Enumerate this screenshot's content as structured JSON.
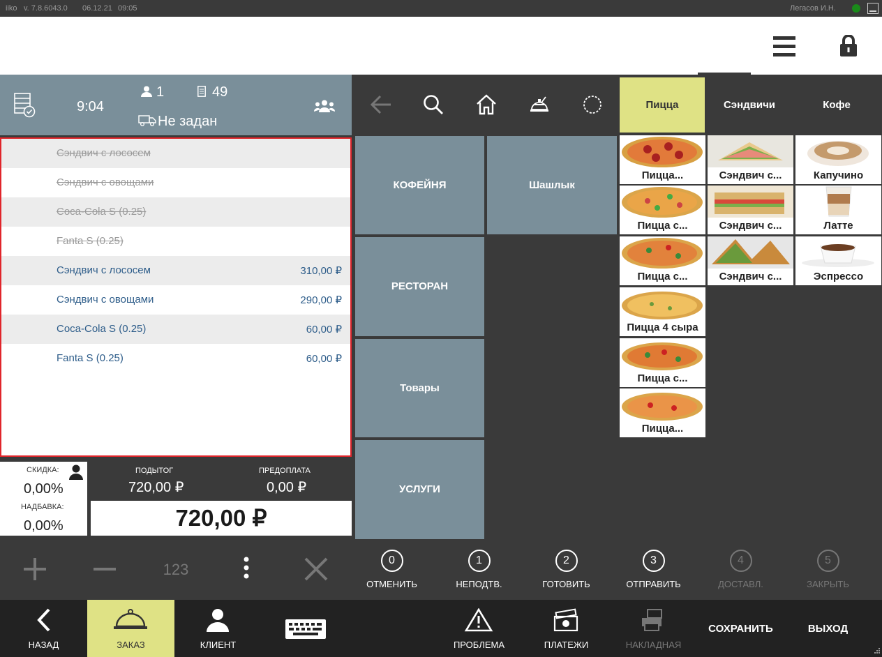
{
  "status_bar": {
    "app": "iiko",
    "version": "v. 7.8.6043.0",
    "date": "06.12.21",
    "time": "09:05",
    "user": "Легасов И.Н."
  },
  "order_header": {
    "time": "9:04",
    "guests": "1",
    "order_number": "49",
    "delivery": "Не задан"
  },
  "order_items": [
    {
      "name": "Сэндвич с лососем",
      "price": "",
      "state": "removed"
    },
    {
      "name": "Сэндвич с овощами",
      "price": "",
      "state": "removed"
    },
    {
      "name": "Coca-Cola S (0.25)",
      "price": "",
      "state": "removed"
    },
    {
      "name": "Fanta S (0.25)",
      "price": "",
      "state": "removed"
    },
    {
      "name": "Сэндвич с лососем",
      "price": "310,00 ₽",
      "state": "active"
    },
    {
      "name": "Сэндвич с овощами",
      "price": "290,00 ₽",
      "state": "active"
    },
    {
      "name": "Coca-Cola S (0.25)",
      "price": "60,00 ₽",
      "state": "active"
    },
    {
      "name": "Fanta S (0.25)",
      "price": "60,00 ₽",
      "state": "active"
    }
  ],
  "totals": {
    "discount_label": "СКИДКА:",
    "discount_value": "0,00%",
    "surcharge_label": "НАДБАВКА:",
    "surcharge_value": "0,00%",
    "subtotal_label": "ПОДЫТОГ",
    "subtotal_value": "720,00 ₽",
    "prepay_label": "ПРЕДОПЛАТА",
    "prepay_value": "0,00 ₽",
    "grand_total": "720,00 ₽"
  },
  "left_actions": {
    "numpad": "123"
  },
  "category_tabs": [
    {
      "label": "Пицца",
      "active": true
    },
    {
      "label": "Сэндвичи",
      "active": false
    },
    {
      "label": "Кофе",
      "active": false
    }
  ],
  "categories": [
    {
      "label": "КОФЕЙНЯ"
    },
    {
      "label": "Шашлык"
    },
    {
      "label": "РЕСТОРАН"
    },
    {
      "label": "Товары"
    },
    {
      "label": "УСЛУГИ"
    }
  ],
  "products": [
    {
      "label": "Пицца...",
      "img": "pizza"
    },
    {
      "label": "Сэндвич с...",
      "img": "sandwich"
    },
    {
      "label": "Капучино",
      "img": "cappuccino"
    },
    {
      "label": "Пицца с...",
      "img": "pizza"
    },
    {
      "label": "Сэндвич с...",
      "img": "sandwich"
    },
    {
      "label": "Латте",
      "img": "latte"
    },
    {
      "label": "Пицца с...",
      "img": "pizza"
    },
    {
      "label": "Сэндвич с...",
      "img": "sandwich"
    },
    {
      "label": "Эспрессо",
      "img": "espresso"
    },
    {
      "label": "Пицца 4 сыра",
      "img": "pizza"
    },
    {
      "label": "Пицца с...",
      "img": "pizza"
    },
    {
      "label": "Пицца...",
      "img": "pizza"
    }
  ],
  "status_steps": [
    {
      "num": "0",
      "label": "ОТМЕНИТЬ",
      "enabled": true
    },
    {
      "num": "1",
      "label": "НЕПОДТВ.",
      "enabled": true
    },
    {
      "num": "2",
      "label": "ГОТОВИТЬ",
      "enabled": true
    },
    {
      "num": "3",
      "label": "ОТПРАВИТЬ",
      "enabled": true
    },
    {
      "num": "4",
      "label": "ДОСТАВЛ.",
      "enabled": false
    },
    {
      "num": "5",
      "label": "ЗАКРЫТЬ",
      "enabled": false
    }
  ],
  "bottom_bar": {
    "back": "НАЗАД",
    "order": "ЗАКАЗ",
    "client": "КЛИЕНТ",
    "problem": "ПРОБЛЕМА",
    "payments": "ПЛАТЕЖИ",
    "invoice": "НАКЛАДНАЯ",
    "save": "СОХРАНИТЬ",
    "exit": "ВЫХОД"
  },
  "colors": {
    "accent": "#dfe285",
    "panel": "#7a8f9a",
    "dark": "#3a3a3a",
    "link": "#2e5d8a",
    "highlight_border": "#e0252b"
  }
}
